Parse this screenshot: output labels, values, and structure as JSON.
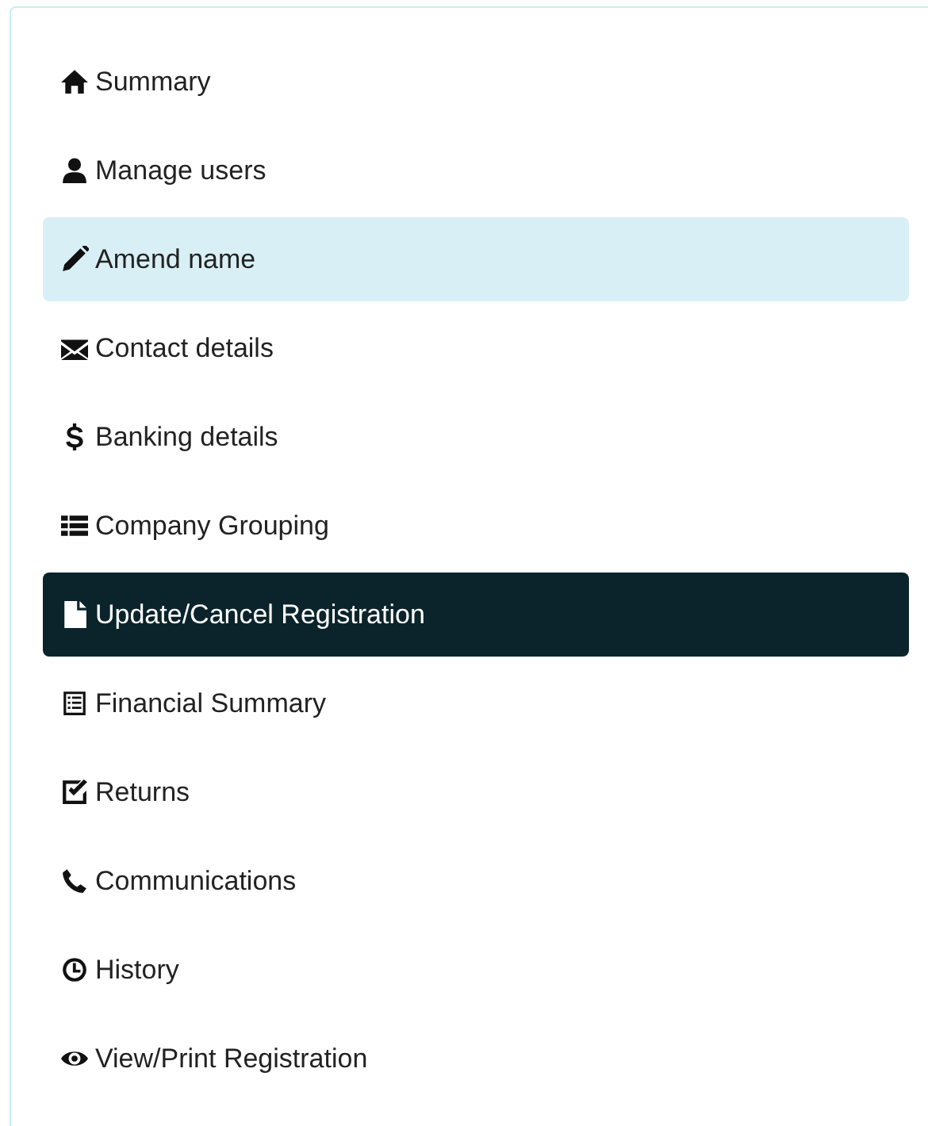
{
  "sidebar": {
    "items": [
      {
        "label": "Summary",
        "selected": false,
        "highlighted": false
      },
      {
        "label": "Manage users",
        "selected": false,
        "highlighted": false
      },
      {
        "label": "Amend name",
        "selected": false,
        "highlighted": true
      },
      {
        "label": "Contact details",
        "selected": false,
        "highlighted": false
      },
      {
        "label": "Banking details",
        "selected": false,
        "highlighted": false
      },
      {
        "label": "Company Grouping",
        "selected": false,
        "highlighted": false
      },
      {
        "label": "Update/Cancel Registration",
        "selected": true,
        "highlighted": false
      },
      {
        "label": "Financial Summary",
        "selected": false,
        "highlighted": false
      },
      {
        "label": "Returns",
        "selected": false,
        "highlighted": false
      },
      {
        "label": "Communications",
        "selected": false,
        "highlighted": false
      },
      {
        "label": "History",
        "selected": false,
        "highlighted": false
      },
      {
        "label": "View/Print Registration",
        "selected": false,
        "highlighted": false
      }
    ]
  }
}
